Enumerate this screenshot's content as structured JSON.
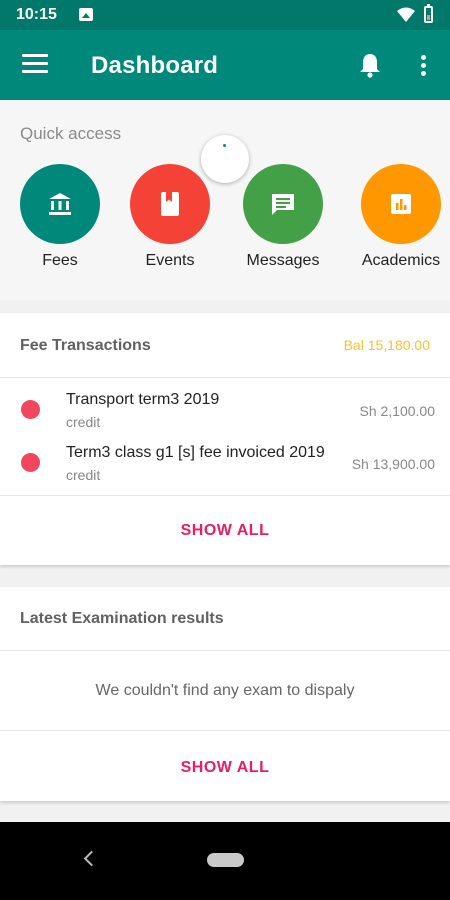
{
  "status_bar": {
    "time": "10:15"
  },
  "app_bar": {
    "title": "Dashboard"
  },
  "quick_access": {
    "label": "Quick access",
    "items": [
      {
        "label": "Fees",
        "color": "#00897b",
        "icon": "bank-icon"
      },
      {
        "label": "Events",
        "color": "#f44336",
        "icon": "book-icon"
      },
      {
        "label": "Messages",
        "color": "#43a047",
        "icon": "message-icon"
      },
      {
        "label": "Academics",
        "color": "#ff9800",
        "icon": "chart-icon"
      }
    ]
  },
  "fee_transactions": {
    "title": "Fee Transactions",
    "balance": "Bal 15,180.00",
    "items": [
      {
        "title": "Transport term3 2019",
        "type": "credit",
        "amount": "Sh 2,100.00"
      },
      {
        "title": "Term3 class g1 [s] fee invoiced 2019",
        "type": "credit",
        "amount": "Sh 13,900.00"
      }
    ],
    "show_all": "SHOW ALL"
  },
  "exam_results": {
    "title": "Latest Examination results",
    "empty_message": "We couldn't find any exam to dispaly",
    "show_all": "SHOW ALL"
  },
  "colors": {
    "primary": "#00897b",
    "primary_dark": "#00796b",
    "accent": "#e91e63",
    "balance": "#fbc02d",
    "dot": "#f2455e"
  }
}
